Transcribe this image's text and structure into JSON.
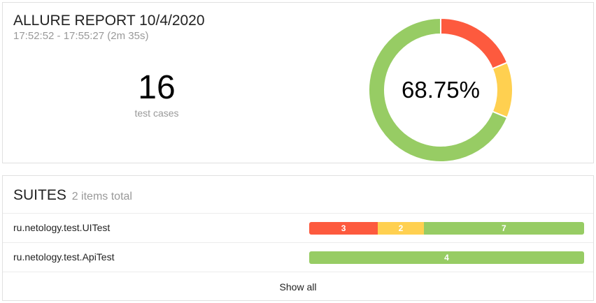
{
  "summary": {
    "title": "ALLURE REPORT 10/4/2020",
    "time_range": "17:52:52 - 17:55:27 (2m 35s)",
    "test_cases_count": "16",
    "test_cases_label": "test cases",
    "success_rate": "68.75%",
    "donut": [
      {
        "status": "failed",
        "count": 3,
        "color": "#fd5a3e"
      },
      {
        "status": "broken",
        "count": 2,
        "color": "#ffd050"
      },
      {
        "status": "passed",
        "count": 11,
        "color": "#97cc64"
      }
    ]
  },
  "suites": {
    "title": "SUITES",
    "total_label": "2 items total",
    "items": [
      {
        "name": "ru.netology.test.UITest",
        "segments": [
          {
            "status": "failed",
            "label": "3",
            "value": 3,
            "color": "#fd5a3e"
          },
          {
            "status": "broken",
            "label": "2",
            "value": 2,
            "color": "#ffd050"
          },
          {
            "status": "passed",
            "label": "7",
            "value": 7,
            "color": "#97cc64"
          }
        ]
      },
      {
        "name": "ru.netology.test.ApiTest",
        "segments": [
          {
            "status": "passed",
            "label": "4",
            "value": 4,
            "color": "#97cc64"
          }
        ]
      }
    ],
    "show_all_label": "Show all"
  }
}
